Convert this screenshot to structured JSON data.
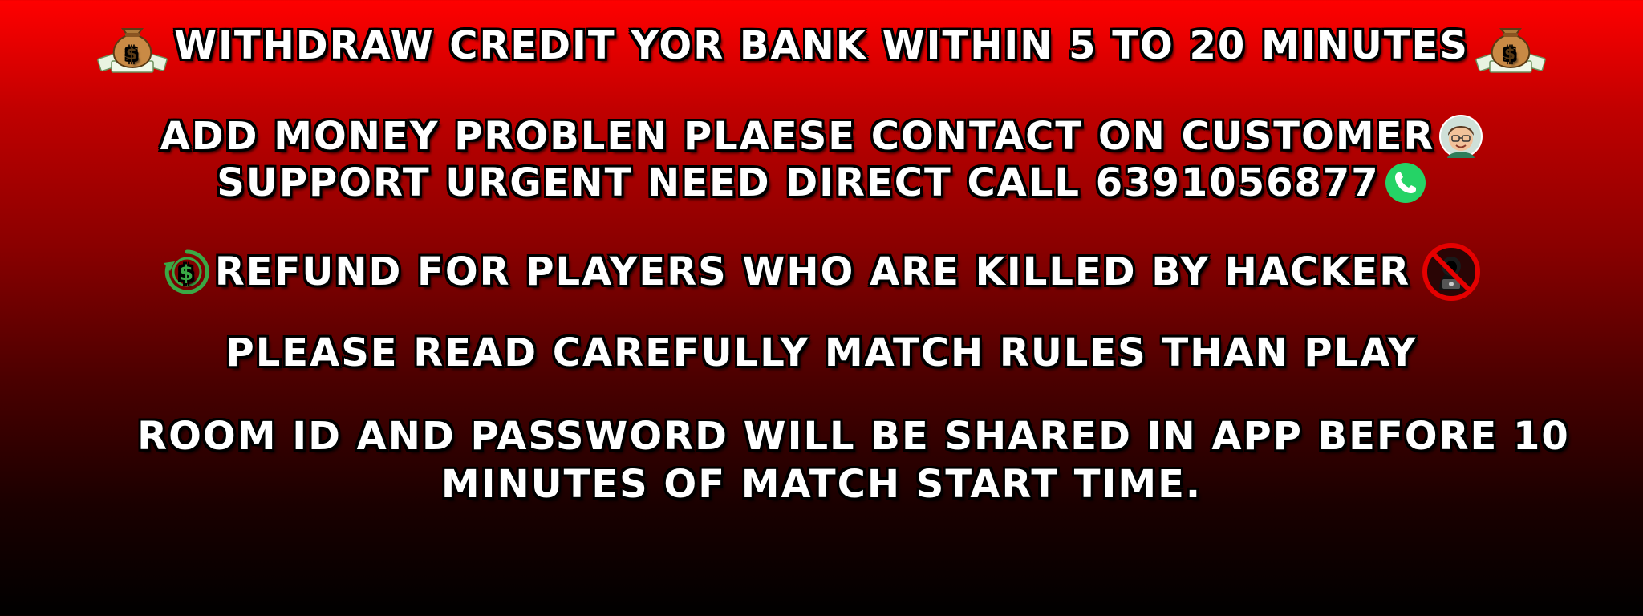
{
  "banner": {
    "line1": "WITHDRAW CREDIT YOR BANK WITHIN 5 TO 20 MINUTES",
    "line2": "ADD MONEY PROBLEN PLAESE CONTACT ON CUSTOMER",
    "line3": "SUPPORT URGENT NEED DIRECT CALL 6391056877",
    "line4": "REFUND FOR PLAYERS WHO ARE KILLED BY HACKER",
    "line5": "PLEASE READ CAREFULLY MATCH RULES THAN PLAY",
    "line6": "ROOM ID AND PASSWORD WILL BE SHARED IN APP BEFORE 10",
    "line7": "MINUTES OF MATCH START TIME."
  },
  "icons": {
    "left_of_line1": "money-bag-icon",
    "right_of_line1": "money-bag-icon",
    "after_line2": "customer-support-icon",
    "after_line3": "whatsapp-call-icon",
    "before_line4": "refund-dollar-icon",
    "after_line4": "no-hacker-icon"
  },
  "colors": {
    "background_top": "#ff0000",
    "background_bottom": "#000000",
    "text": "#ffffff",
    "text_outline": "#000000",
    "whatsapp_green": "#25d366",
    "refund_green": "#3aa845",
    "prohibit_red": "#e50000"
  }
}
